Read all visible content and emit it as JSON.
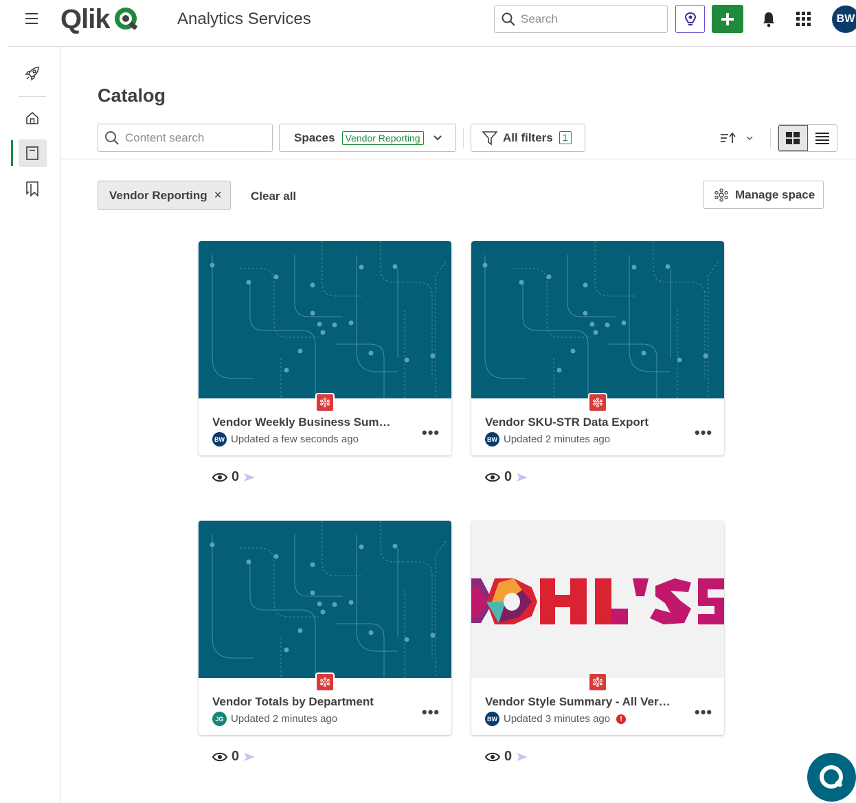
{
  "header": {
    "brand": "Qlik",
    "app_title": "Analytics Services",
    "search_placeholder": "Search",
    "user_initials": "BW"
  },
  "page": {
    "title": "Catalog",
    "content_search_placeholder": "Content search",
    "spaces_label": "Spaces",
    "spaces_selected": "Vendor Reporting",
    "all_filters_label": "All filters",
    "all_filters_count": "1",
    "active_chip": "Vendor Reporting",
    "chip_remove": "×",
    "clear_all": "Clear all",
    "manage_space": "Manage space"
  },
  "cards": [
    {
      "title": "Vendor Weekly Business Sum…",
      "owner_initials": "BW",
      "updated": "Updated a few seconds ago",
      "views": "0",
      "thumbnail": "circuit"
    },
    {
      "title": "Vendor SKU-STR Data Export",
      "owner_initials": "BW",
      "updated": "Updated 2 minutes ago",
      "views": "0",
      "thumbnail": "circuit"
    },
    {
      "title": "Vendor Totals by Department",
      "owner_initials": "JG",
      "updated": "Updated 2 minutes ago",
      "views": "0",
      "thumbnail": "circuit"
    },
    {
      "title": "Vendor Style Summary - All Ver…",
      "owner_initials": "BW",
      "updated": "Updated 3 minutes ago",
      "views": "0",
      "thumbnail": "kohls",
      "error": "!"
    }
  ],
  "colors": {
    "accent_green": "#1f8a3c",
    "thumb_teal": "#035e76",
    "app_badge_red": "#d93a3a",
    "insight_purple": "#6a50d6"
  },
  "icons": [
    "menu-icon",
    "search-icon",
    "insight-advisor-icon",
    "plus-icon",
    "bell-icon",
    "app-grid-icon",
    "rocket-icon",
    "home-icon",
    "catalog-icon",
    "collections-icon",
    "filter-icon",
    "sort-icon",
    "grid-view-icon",
    "list-view-icon",
    "space-icon",
    "eye-icon",
    "arrow-right-icon",
    "qlik-chat-icon"
  ]
}
